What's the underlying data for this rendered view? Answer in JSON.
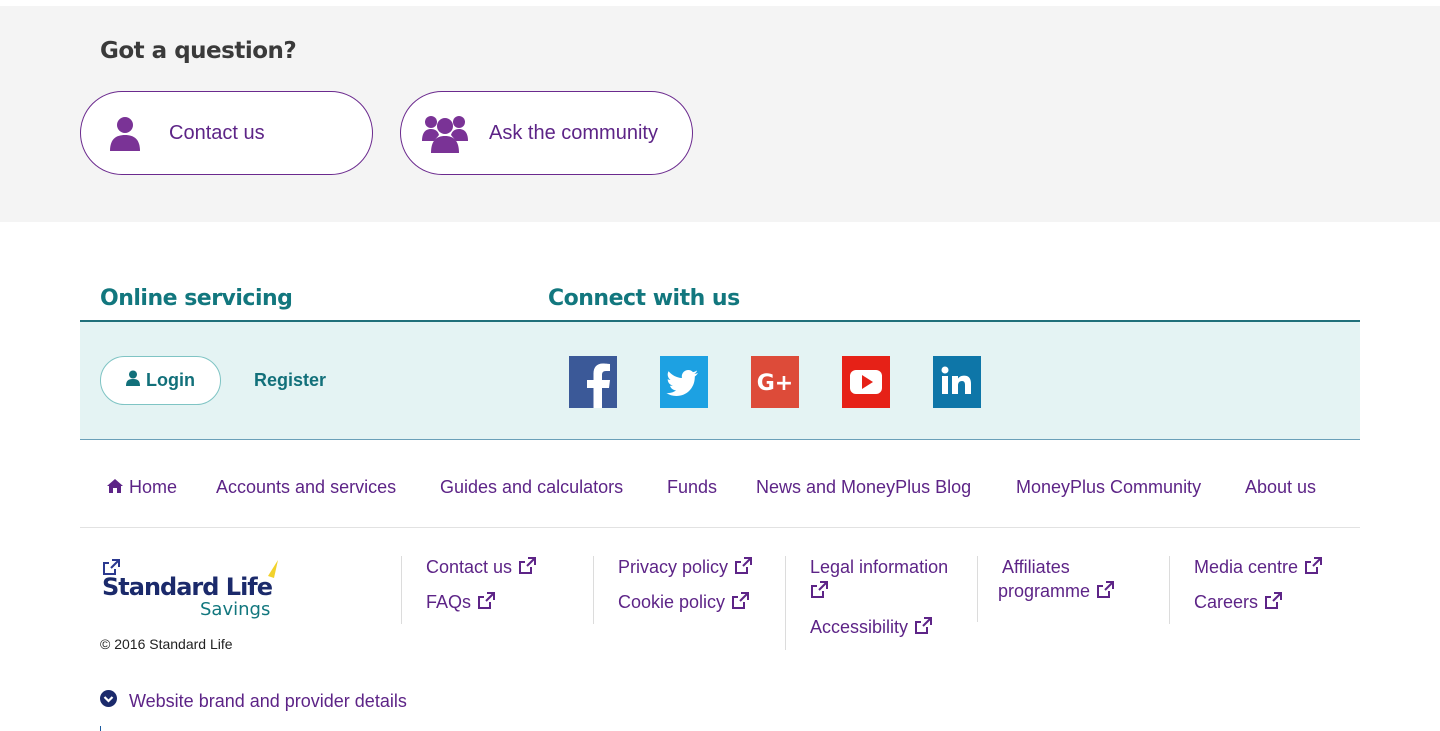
{
  "question": {
    "title": "Got a question?",
    "contact_label": "Contact us",
    "community_label": "Ask the community"
  },
  "online_servicing": {
    "heading": "Online servicing",
    "login_label": "Login",
    "register_label": "Register"
  },
  "connect": {
    "heading": "Connect with us",
    "networks": [
      {
        "name": "facebook-icon",
        "color": "#3b5998"
      },
      {
        "name": "twitter-icon",
        "color": "#1da1e2"
      },
      {
        "name": "google-plus-icon",
        "color": "#dd4b39"
      },
      {
        "name": "youtube-icon",
        "color": "#e62117"
      },
      {
        "name": "linkedin-icon",
        "color": "#0e76a8"
      }
    ]
  },
  "nav": {
    "home": "Home",
    "accounts": "Accounts and services",
    "guides": "Guides and calculators",
    "funds": "Funds",
    "news": "News and MoneyPlus Blog",
    "community": "MoneyPlus Community",
    "about": "About us"
  },
  "brand": {
    "name_line1": "Standard Life",
    "name_line2": "Savings",
    "copyright": "© 2016 Standard Life"
  },
  "footer_links": {
    "contact_us": "Contact us",
    "faqs": "FAQs",
    "privacy_policy": "Privacy policy",
    "cookie_policy": "Cookie policy",
    "legal_information": "Legal information",
    "accessibility": "Accessibility",
    "affiliates_line1": "Affiliates",
    "affiliates_line2": "programme",
    "media_centre": "Media centre",
    "careers": "Careers"
  },
  "brand_details": {
    "label": "Website brand and provider details"
  },
  "colors": {
    "purple": "#5d2487",
    "teal": "#12777e",
    "band_bg": "#e4f3f3"
  }
}
